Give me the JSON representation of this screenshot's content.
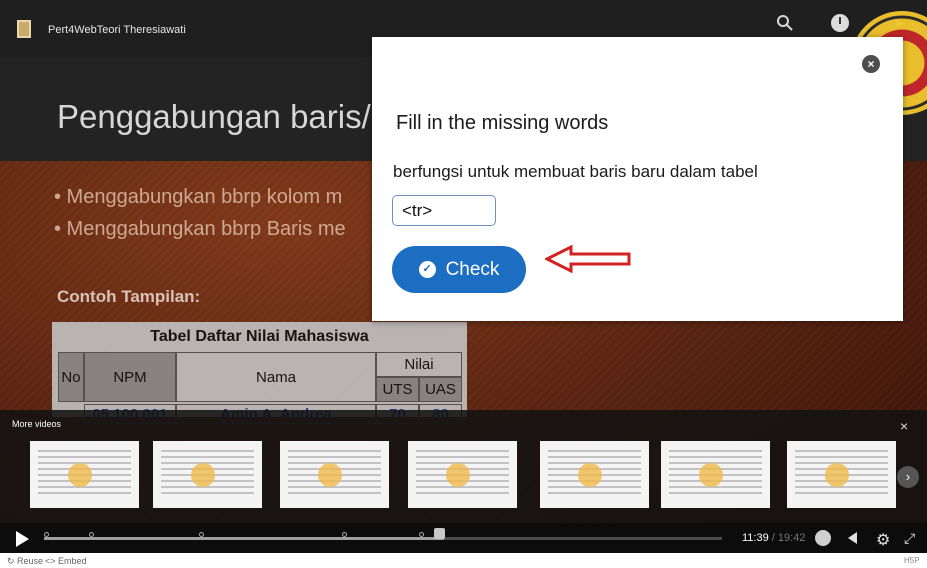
{
  "player": {
    "title": "Pert4WebTeori Theresiawati",
    "slide_title": "Penggabungan baris/",
    "bullets": [
      "• Menggabungkan bbrp kolom m",
      "• Menggabungkan bbrp Baris me"
    ],
    "example_label": "Contoh Tampilan:",
    "table": {
      "caption": "Tabel Daftar Nilai Mahasiswa",
      "headers": {
        "no": "No",
        "npm": "NPM",
        "nama": "Nama",
        "nilai": "Nilai",
        "uts": "UTS",
        "uas": "UAS"
      },
      "row": {
        "npm": "05.100.001",
        "nama": "Amin A. Andrea",
        "uts": "70",
        "uas": "80"
      }
    }
  },
  "modal": {
    "title": "Fill in the missing words",
    "question": "berfungsi untuk membuat baris baru dalam tabel",
    "answer_value": "<tr>",
    "check_label": "Check",
    "close_glyph": "×"
  },
  "more_videos": {
    "label": "More videos",
    "close_glyph": "×",
    "next_glyph": "›",
    "thumb_count": 7
  },
  "controls": {
    "time_current": "11:39",
    "time_total": "19:42",
    "progress": 0.59,
    "gear_glyph": "⚙",
    "fullscreen_glyph": "⤢"
  },
  "footer": {
    "reuse_label": "↻ Reuse",
    "embed_label": "<> Embed",
    "h5p_label": "H5P"
  },
  "colors": {
    "accent": "#1b6ec2",
    "annotation_arrow": "#d32020",
    "slide_background": "#6d2f1a"
  }
}
